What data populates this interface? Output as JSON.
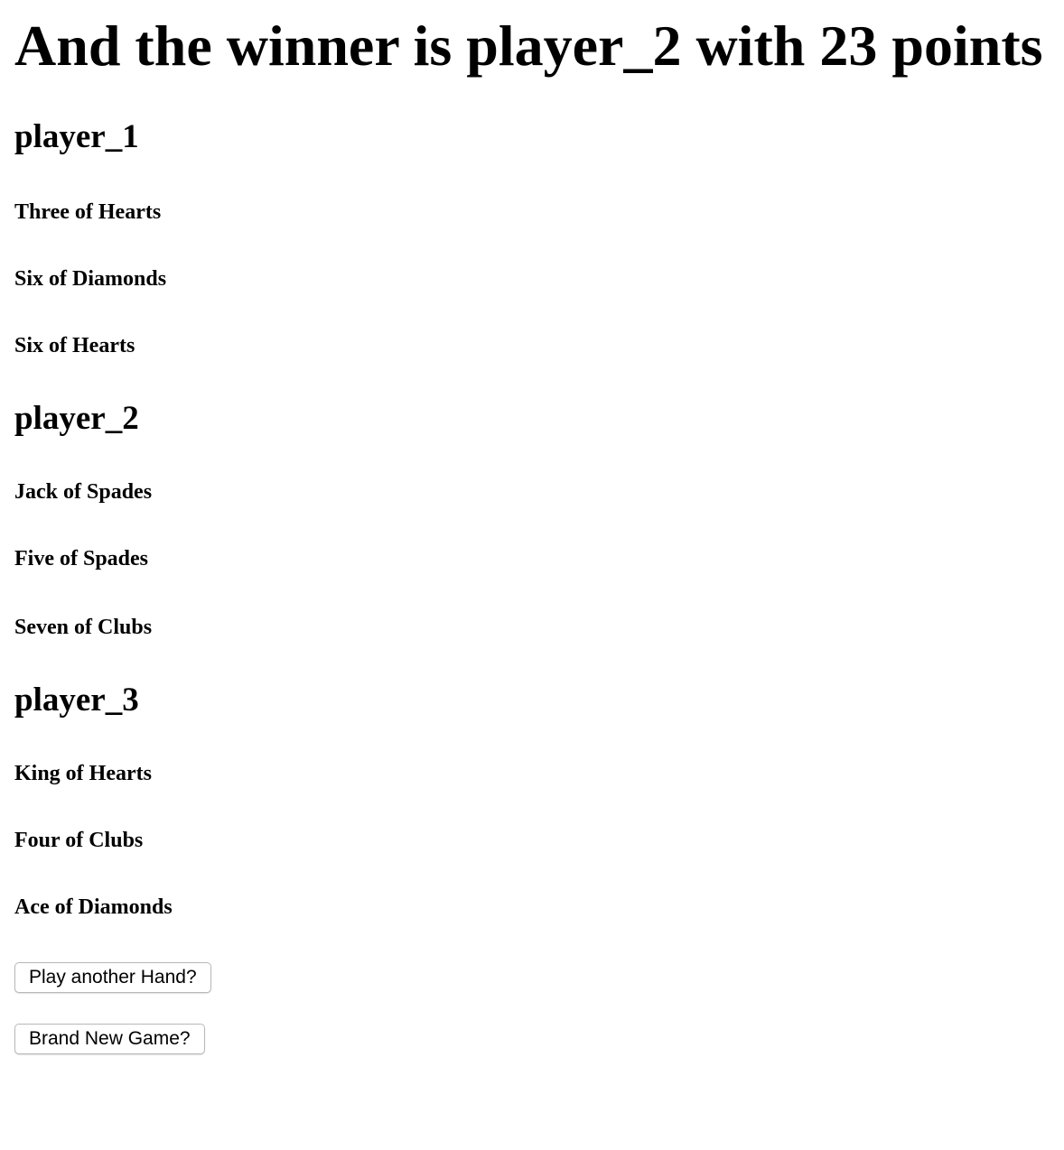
{
  "result": {
    "title": "And the winner is player_2 with 23 points"
  },
  "players": [
    {
      "name": "player_1",
      "cards": [
        "Three of Hearts",
        "Six of Diamonds",
        "Six of Hearts"
      ]
    },
    {
      "name": "player_2",
      "cards": [
        "Jack of Spades",
        "Five of Spades",
        "Seven of Clubs"
      ]
    },
    {
      "name": "player_3",
      "cards": [
        "King of Hearts",
        "Four of Clubs",
        "Ace of Diamonds"
      ]
    }
  ],
  "actions": {
    "play_another_label": "Play another Hand?",
    "new_game_label": "Brand New Game?"
  }
}
